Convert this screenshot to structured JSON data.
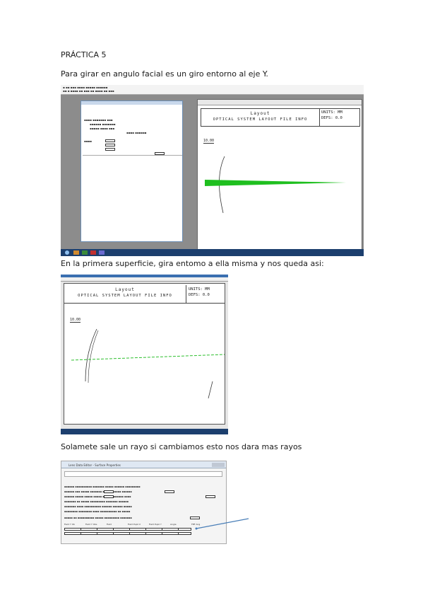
{
  "document": {
    "heading": "PRÁCTICA 5",
    "paragraph1": "Para girar en angulo facial es un giro entorno al eje Y.",
    "paragraph2": "En la primera superficie, gira entomo a ella misma y nos queda asi:",
    "paragraph3": "Solamete sale un rayo si cambiamos esto nos dara mas rayos"
  },
  "screenshot1": {
    "layout_title": "Layout",
    "layout_subtitle": "OPTICAL SYSTEM LAYOUT FILE INFO",
    "units_label": "UNITS: MM",
    "units_value": "DEFS: 0.0",
    "scale_label": "10.00",
    "ray_color": "#1fbf1f"
  },
  "screenshot2": {
    "layout_title": "Layout",
    "layout_subtitle": "OPTICAL SYSTEM LAYOUT FILE INFO",
    "units_label": "UNITS: MM",
    "units_value": "DEFS: 0.0",
    "scale_label": "10.00",
    "ray_color": "#2fbf2f"
  },
  "screenshot3": {
    "window_title": "Lens Data Editor - Surface Properties",
    "table_headers": [
      "Field Y Ob",
      "Field Y Obs",
      "Field",
      "Field Pupil X",
      "Field Pupil Y",
      "Angle",
      "FBF Ang"
    ]
  }
}
